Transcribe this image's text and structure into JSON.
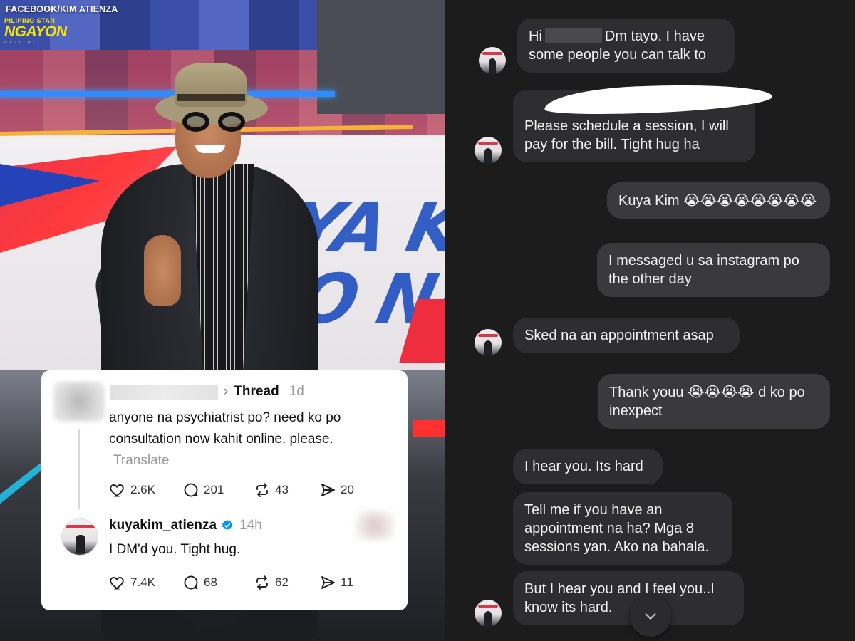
{
  "watermark": {
    "source": "FACEBOOK/KIM ATIENZA",
    "logo_small": "PILIPINO STAR",
    "logo_big": "NGAYON",
    "logo_tiny": "DIGITAL"
  },
  "studio_wall_text": "YA KIM\n O NA",
  "thread_post": {
    "meta_label": "Thread",
    "meta_time": "1d",
    "text": "anyone na psychiatrist po? need ko po consultation now kahit online. please.",
    "translate_label": "Translate",
    "likes": "2.6K",
    "replies": "201",
    "reposts": "43",
    "shares": "20"
  },
  "reply": {
    "handle": "kuyakim_atienza",
    "time": "14h",
    "text": "I DM'd you. Tight hug.",
    "likes": "7.4K",
    "replies": "68",
    "reposts": "62",
    "shares": "11"
  },
  "chat": {
    "messages": [
      {
        "from": "them",
        "pre": "Hi",
        "post": "Dm tayo. I have some people you can talk to"
      },
      {
        "from": "them",
        "text": "Please schedule a session, I will pay for the bill. Tight hug ha"
      },
      {
        "from": "me",
        "text": "Kuya Kim",
        "emoji": "😭😭😭😭😭😭😭😭"
      },
      {
        "from": "me",
        "text": "I messaged u sa instagram po the other day"
      },
      {
        "from": "them",
        "text": "Sked na an appointment asap"
      },
      {
        "from": "me",
        "text": "Thank youu",
        "emoji": "😭😭😭😭",
        "text_after": "d ko po inexpect"
      },
      {
        "from": "them",
        "text": "I hear you. Its hard"
      },
      {
        "from": "them",
        "text": "Tell me if you have an appointment na ha? Mga 8 sessions yan. Ako na bahala."
      },
      {
        "from": "them",
        "text": "But I hear you and I feel you..I know its hard."
      }
    ]
  },
  "colors": {
    "chat_bg": "#1c1c1d",
    "bubble_in": "#2e2e30",
    "bubble_out": "#3a3a3c",
    "verified": "#0095f6",
    "watermark_yellow": "#f6e500"
  }
}
